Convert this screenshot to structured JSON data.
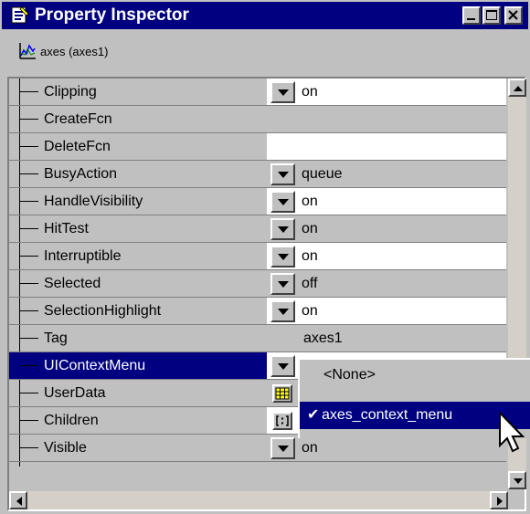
{
  "window": {
    "title": "Property Inspector",
    "object_label": "axes (axes1)",
    "controls": [
      "minimize-icon",
      "maximize-icon",
      "close-icon"
    ]
  },
  "properties": [
    {
      "name": "Clipping",
      "value": "on",
      "editor": "dropdown"
    },
    {
      "name": "CreateFcn",
      "value": "",
      "editor": "text"
    },
    {
      "name": "DeleteFcn",
      "value": "",
      "editor": "text"
    },
    {
      "name": "BusyAction",
      "value": "queue",
      "editor": "dropdown"
    },
    {
      "name": "HandleVisibility",
      "value": "on",
      "editor": "dropdown"
    },
    {
      "name": "HitTest",
      "value": "on",
      "editor": "dropdown"
    },
    {
      "name": "Interruptible",
      "value": "on",
      "editor": "dropdown"
    },
    {
      "name": "Selected",
      "value": "off",
      "editor": "dropdown"
    },
    {
      "name": "SelectionHighlight",
      "value": "on",
      "editor": "dropdown"
    },
    {
      "name": "Tag",
      "value": "axes1",
      "editor": "text"
    },
    {
      "name": "UIContextMenu",
      "value": "",
      "editor": "dropdown",
      "selected": true
    },
    {
      "name": "UserData",
      "value": "",
      "editor": "grid-icon"
    },
    {
      "name": "Children",
      "value": "",
      "editor": "array-icon"
    },
    {
      "name": "Visible",
      "value": "on",
      "editor": "dropdown"
    }
  ],
  "context_menu_dropdown": {
    "options": [
      "<None>",
      "axes_context_menu"
    ],
    "selected": "axes_context_menu",
    "check_mark": "✔"
  },
  "colors": {
    "title_bar": "#000080",
    "selection": "#000080",
    "background": "#c0c0c0"
  }
}
